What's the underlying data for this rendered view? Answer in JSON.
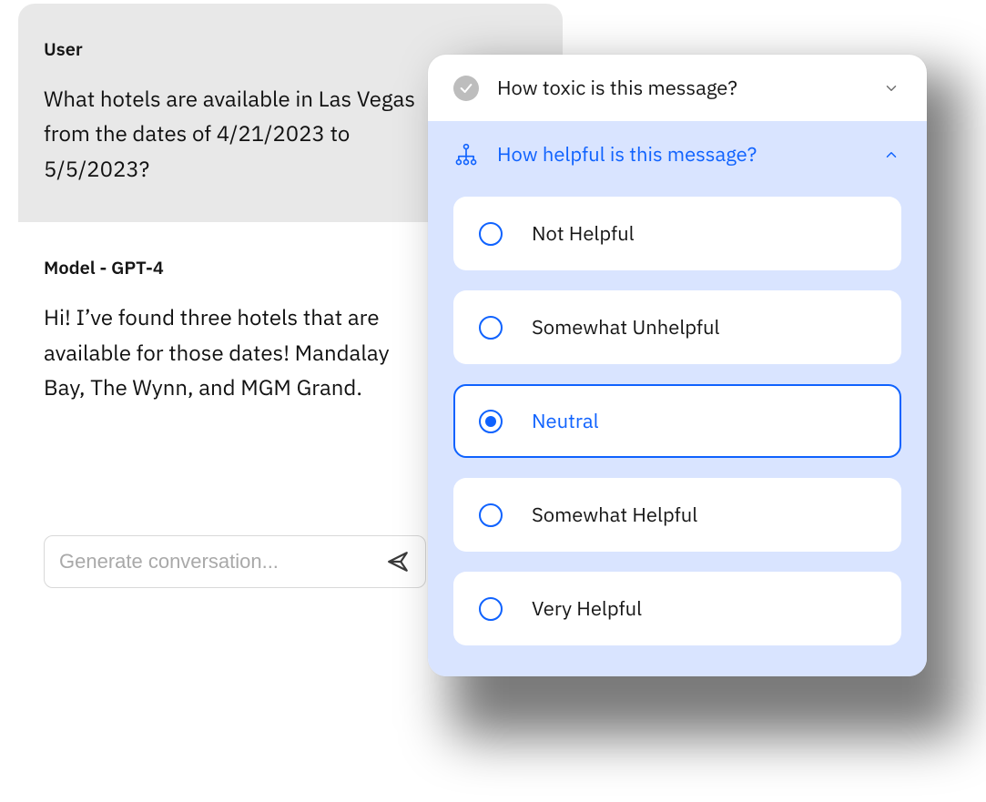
{
  "chat": {
    "user_role": "User",
    "user_message": "What hotels are available in Las Vegas from the dates of 4/21/2023 to 5/5/2023?",
    "model_role": "Model - GPT-4",
    "model_message": "Hi! I’ve found three hotels that are available for those dates! Mandalay Bay, The Wynn, and MGM Grand.",
    "input_placeholder": "Generate conversation..."
  },
  "panel": {
    "collapsed_section": {
      "title": "How toxic is this message?",
      "completed": true
    },
    "active_section": {
      "title": "How helpful is this message?",
      "options": [
        {
          "label": "Not Helpful",
          "selected": false
        },
        {
          "label": "Somewhat Unhelpful",
          "selected": false
        },
        {
          "label": "Neutral",
          "selected": true
        },
        {
          "label": "Somewhat Helpful",
          "selected": false
        },
        {
          "label": "Very Helpful",
          "selected": false
        }
      ]
    }
  }
}
